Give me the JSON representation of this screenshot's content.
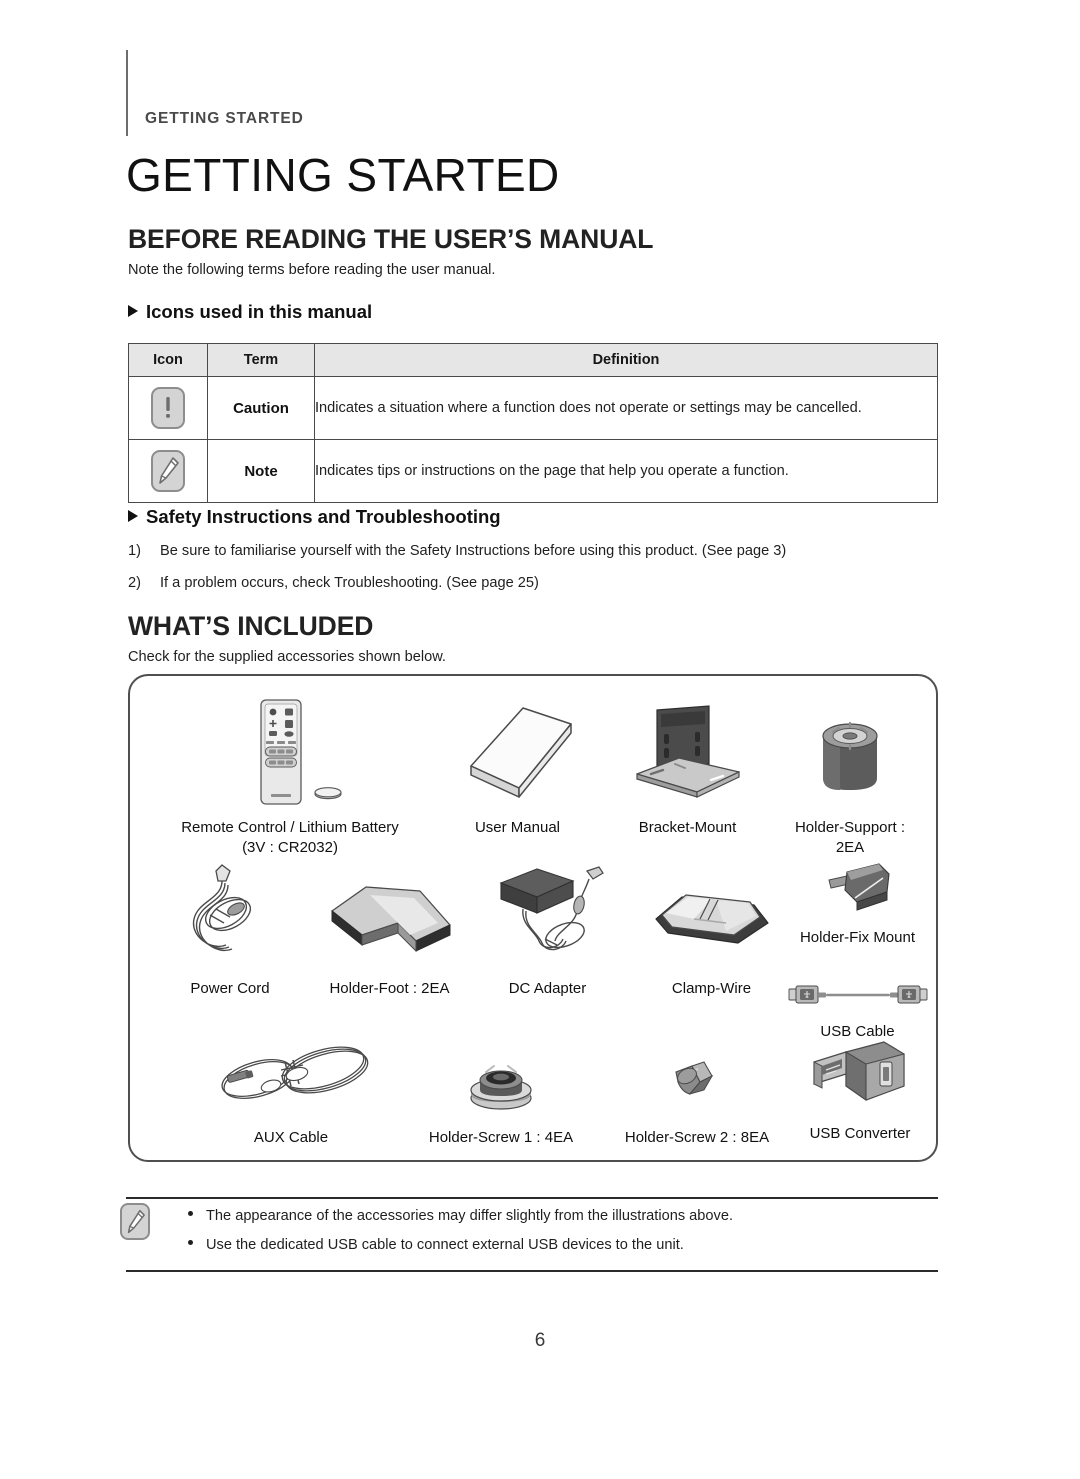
{
  "page": {
    "running_head": "GETTING STARTED",
    "chapter_title": "GETTING STARTED",
    "page_number": "6"
  },
  "section_manual": {
    "heading": "BEFORE READING THE USER’S MANUAL",
    "intro": "Note the following terms before reading the user manual.",
    "sub_icons_heading": "Icons used in this manual",
    "table": {
      "headers": [
        "Icon",
        "Term",
        "Definition"
      ],
      "rows": [
        {
          "icon": "caution-exclamation-icon",
          "term": "Caution",
          "definition": "Indicates a situation where a function does not operate or settings may be cancelled."
        },
        {
          "icon": "note-pencil-icon",
          "term": "Note",
          "definition": "Indicates tips or instructions on the page that help you operate a function."
        }
      ]
    },
    "sub_safety_heading": "Safety Instructions and Troubleshooting",
    "safety_items": [
      {
        "number": "1)",
        "text": "Be sure to familiarise yourself with the Safety Instructions before using this product. (See page 3)"
      },
      {
        "number": "2)",
        "text": "If a problem occurs, check Troubleshooting. (See page 25)"
      }
    ]
  },
  "section_included": {
    "heading": "WHAT’S INCLUDED",
    "intro": "Check for the supplied accessories shown below.",
    "accessories": [
      {
        "id": "remote-control",
        "label": "Remote Control / Lithium Battery\n(3V : CR2032)"
      },
      {
        "id": "user-manual",
        "label": "User Manual"
      },
      {
        "id": "bracket-mount",
        "label": "Bracket-Mount"
      },
      {
        "id": "holder-support",
        "label": "Holder-Support :\n2EA"
      },
      {
        "id": "power-cord",
        "label": "Power Cord"
      },
      {
        "id": "holder-foot",
        "label": "Holder-Foot : 2EA"
      },
      {
        "id": "dc-adapter",
        "label": "DC Adapter"
      },
      {
        "id": "clamp-wire",
        "label": "Clamp-Wire"
      },
      {
        "id": "holder-fix-mount",
        "label": "Holder-Fix Mount"
      },
      {
        "id": "usb-cable",
        "label": "USB Cable"
      },
      {
        "id": "aux-cable",
        "label": "AUX Cable"
      },
      {
        "id": "holder-screw-1",
        "label": "Holder-Screw 1 : 4EA"
      },
      {
        "id": "holder-screw-2",
        "label": "Holder-Screw 2 : 8EA"
      },
      {
        "id": "usb-converter",
        "label": "USB Converter"
      }
    ]
  },
  "footer_note": {
    "icon": "note-pencil-icon",
    "bullets": [
      "The appearance of the accessories may differ slightly from the illustrations above.",
      "Use the dedicated USB cable to connect external USB devices to the unit."
    ]
  },
  "colors": {
    "rule": "#6d6d6d",
    "table_header_bg": "#e6e6e6",
    "panel_border": "#4f6f6f",
    "text": "#1f1f1f"
  }
}
